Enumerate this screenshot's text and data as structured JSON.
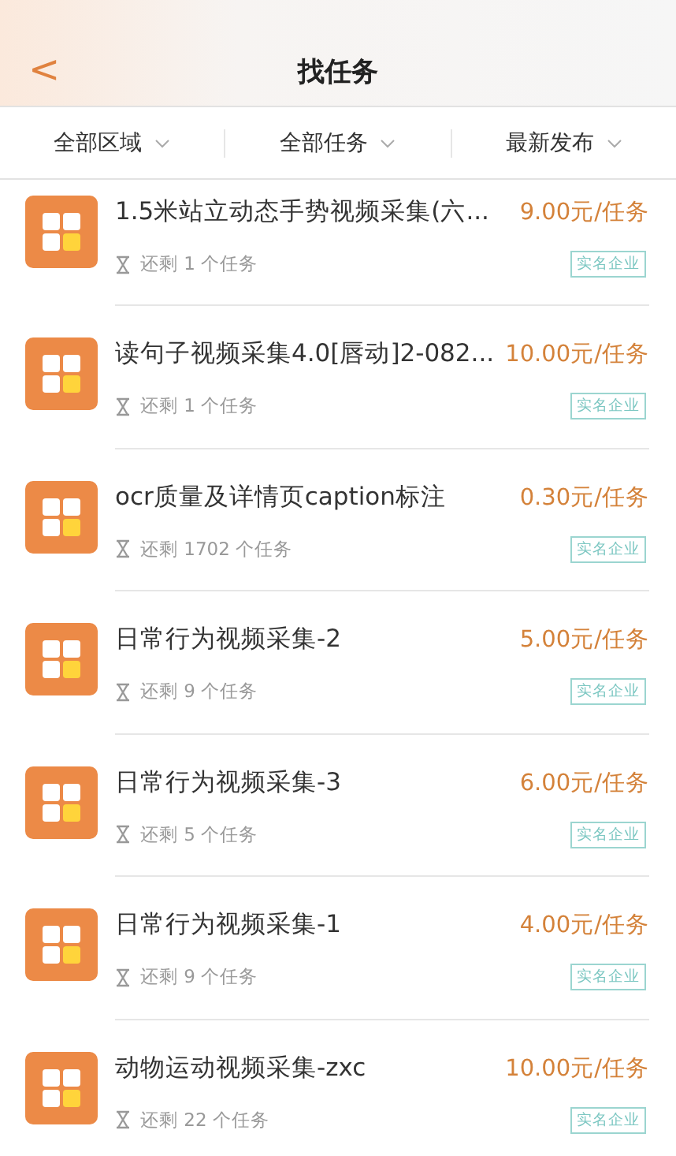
{
  "header": {
    "back": "<",
    "title": "找任务"
  },
  "filters": [
    {
      "label": "全部区域"
    },
    {
      "label": "全部任务"
    },
    {
      "label": "最新发布"
    }
  ],
  "tasks": [
    {
      "title": "1.5米站立动态手势视频采集(六...",
      "price": "9.00元/任务",
      "remaining": "还剩 1 个任务",
      "badge": "实名企业"
    },
    {
      "title": "读句子视频采集4.0[唇动]2-082...",
      "price": "10.00元/任务",
      "remaining": "还剩 1 个任务",
      "badge": "实名企业"
    },
    {
      "title": "ocr质量及详情页caption标注",
      "price": "0.30元/任务",
      "remaining": "还剩 1702 个任务",
      "badge": "实名企业"
    },
    {
      "title": "日常行为视频采集-2",
      "price": "5.00元/任务",
      "remaining": "还剩 9 个任务",
      "badge": "实名企业"
    },
    {
      "title": "日常行为视频采集-3",
      "price": "6.00元/任务",
      "remaining": "还剩 5 个任务",
      "badge": "实名企业"
    },
    {
      "title": "日常行为视频采集-1",
      "price": "4.00元/任务",
      "remaining": "还剩 9 个任务",
      "badge": "实名企业"
    },
    {
      "title": "动物运动视频采集-zxc",
      "price": "10.00元/任务",
      "remaining": "还剩 22 个任务",
      "badge": "实名企业"
    }
  ]
}
